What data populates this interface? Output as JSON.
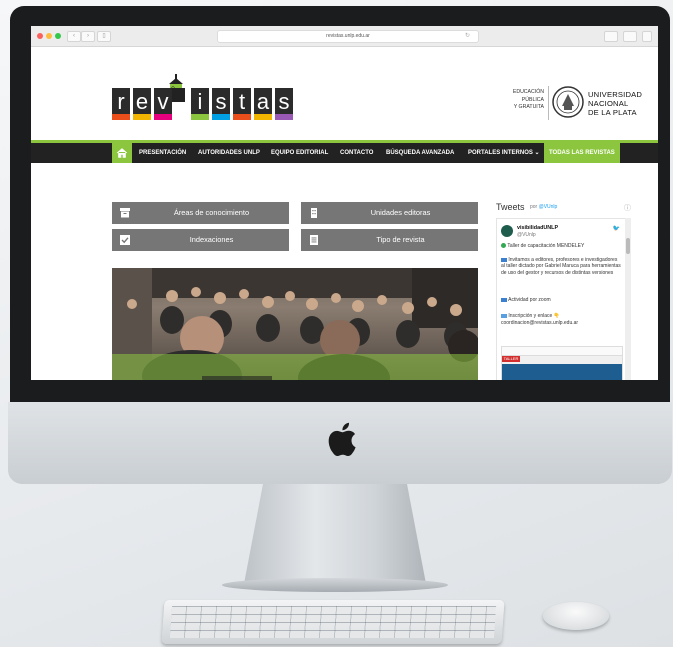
{
  "browser": {
    "url": "revistas.unlp.edu.ar"
  },
  "logo": {
    "letters": [
      "r",
      "e",
      "v",
      "i",
      "s",
      "t",
      "a",
      "s"
    ],
    "strip_colors": [
      "#e94e1b",
      "#f2b600",
      "#e6007e",
      "#8cc63f",
      "#00a0e3",
      "#e94e1b",
      "#f2b600",
      "#9b59b6"
    ],
    "unlp_label": "UNLP"
  },
  "university": {
    "edu_lines": [
      "EDUCACIÓN",
      "PÚBLICA",
      "Y GRATUITA"
    ],
    "name_lines": [
      "UNIVERSIDAD",
      "NACIONAL",
      "DE LA PLATA"
    ]
  },
  "menu": {
    "items": [
      "PRESENTACIÓN",
      "AUTORIDADES UNLP",
      "EQUIPO EDITORIAL",
      "CONTACTO",
      "BÚSQUEDA AVANZADA",
      "PORTALES INTERNOS ⌄",
      "TODAS LAS REVISTAS"
    ]
  },
  "buttons": {
    "areas": "Áreas de conocimiento",
    "unidades": "Unidades editoras",
    "indexaciones": "Indexaciones",
    "tipo": "Tipo de revista"
  },
  "tweets": {
    "title": "Tweets",
    "by_prefix": "por",
    "by_handle": "@VUnlp",
    "info_icon": "ⓘ",
    "account_name": "visibilidadUNLP",
    "account_handle": "@VUnlp",
    "line1": "Taller de capacitación MENDELEY",
    "line2": "Invitamos a editores, profesores e investigadores al taller dictado por Gabriel Maruca para herramientas de uso del gestor y recursos de distintas versiones",
    "line3": "Actividad por zoom",
    "line4": "Inscripción y enlace 👇",
    "line5": "coordinacion@revistas.unlp.edu.ar",
    "media_label": "TALLER"
  },
  "colors": {
    "accent_green": "#8cc63f",
    "menu_bg": "#222222",
    "button_gray": "#767676"
  }
}
